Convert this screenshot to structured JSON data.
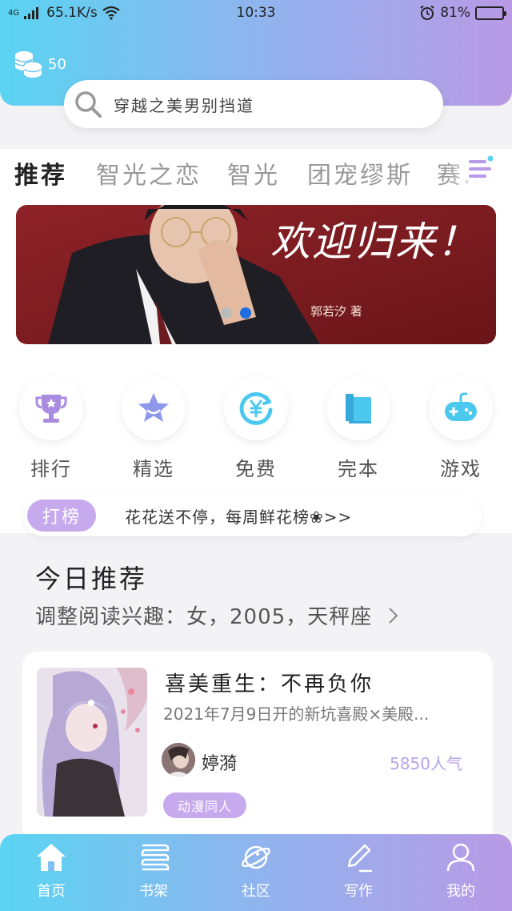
{
  "status_bar": {
    "signal_label": "4G",
    "speed": "65.1K/s",
    "time": "10:33",
    "battery_percent": "81%",
    "battery_level": 0.81
  },
  "coins": {
    "count": "50",
    "icon": "coin-stack-icon"
  },
  "search": {
    "query": "穿越之美男别挡道",
    "icon": "search-icon"
  },
  "tabs": [
    {
      "label": "推荐",
      "active": true
    },
    {
      "label": "智光之恋",
      "active": false
    },
    {
      "label": "智光",
      "active": false
    },
    {
      "label": "团宠缪斯",
      "active": false
    },
    {
      "label": "赛...",
      "active": false
    }
  ],
  "banner": {
    "title_text": "欢迎归来！",
    "author_text": "郭若汐 著",
    "slide_count": 2,
    "active_slide": 2
  },
  "quick_links": [
    {
      "label": "排行",
      "icon": "trophy-icon"
    },
    {
      "label": "精选",
      "icon": "star-icon"
    },
    {
      "label": "免费",
      "icon": "yen-coin-icon"
    },
    {
      "label": "完本",
      "icon": "book-icon"
    },
    {
      "label": "游戏",
      "icon": "gamepad-icon"
    }
  ],
  "notice": {
    "badge": "打榜",
    "message": "花花送不停，每周鲜花榜❀>>"
  },
  "today": {
    "title": "今日推荐",
    "subtitle": "调整阅读兴趣：女，2005，天秤座",
    "chevron": "chevron-right-icon"
  },
  "book": {
    "title": "喜美重生：不再负你",
    "description": "2021年7月9日开的新坑喜殿×美殿...",
    "author": "婷漪",
    "popularity": "5850人气",
    "tag": "动漫同人"
  },
  "bottom_nav": [
    {
      "label": "首页",
      "icon": "home-icon",
      "active": true
    },
    {
      "label": "书架",
      "icon": "bookshelf-icon",
      "active": false
    },
    {
      "label": "社区",
      "icon": "planet-icon",
      "active": false
    },
    {
      "label": "写作",
      "icon": "pen-icon",
      "active": false
    },
    {
      "label": "我的",
      "icon": "user-icon",
      "active": false
    }
  ],
  "colors": {
    "gradient_start": "#5ad4f2",
    "gradient_end": "#b99ae6",
    "accent_purple": "#c7a9ee",
    "dot_active": "#1e6ee0"
  }
}
